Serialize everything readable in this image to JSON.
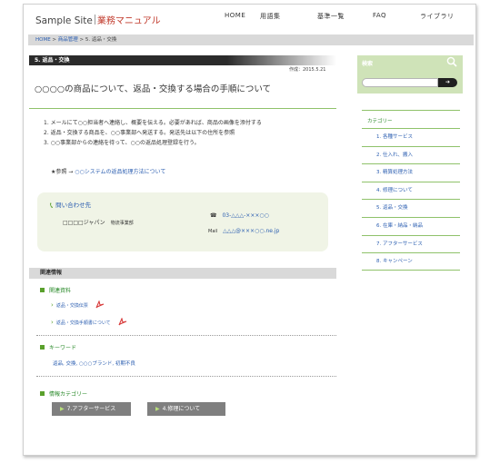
{
  "header": {
    "logo_main": "Sample Site",
    "logo_sub": "業務マニュアル",
    "nav": [
      "HOME",
      "用語集",
      "基準一覧",
      "FAQ",
      "ライブラリ"
    ]
  },
  "breadcrumb": {
    "home": "HOME",
    "sep": " > ",
    "parent": "商品管理",
    "current": "5. 返品・交換"
  },
  "page": {
    "section_label": "5. 返品・交換",
    "date": "作成：2015.5.21",
    "title": "○○○○の商品について、返品・交換する場合の手順について",
    "steps": [
      "1. メールにて○○担当者へ連絡し、概要を伝える。必要があれば、商品の画像を添付する",
      "2. 返品・交換する商品を、○○事業部へ発送する。発送先は以下の住所を参照",
      "3. ○○事業部からの連絡を待って、○○の返品処理登録を行う。"
    ],
    "star_prefix": "★参照 →",
    "star_link": "○○システムの返品処理方法について"
  },
  "contact": {
    "heading": "問い合わせ先",
    "org": "□□□□ジャパン",
    "dept": "物流事業部",
    "tel_icon": "☎",
    "tel": "03-△△△-×××○○",
    "mail_label": "Mail",
    "mail": "△△△@×××○○.ne.jp"
  },
  "related": {
    "bar": "関連情報",
    "materials_heading": "関連資料",
    "materials": [
      "返品・交換伝票",
      "返品・交換手順書について"
    ],
    "keywords_heading": "キーワード",
    "keywords": "返品, 交換, ○○○ブランド, 初期不良",
    "category_heading": "情報カテゴリー",
    "category_buttons": [
      "7.アフターサービス",
      "4.修理について"
    ]
  },
  "sidebar": {
    "search_label": "検索",
    "search_placeholder": "",
    "category_title": "カテゴリー",
    "categories": [
      "1. 各種サービス",
      "2. 仕入れ、搬入",
      "3. 精算処理方法",
      "4. 修理について",
      "5. 返品・交換",
      "6. 在庫・納品・納品",
      "7. アフターサービス",
      "8. キャンペーン"
    ]
  },
  "colors": {
    "accent_green": "#5aa02c",
    "link_blue": "#2a5db0",
    "logo_red": "#c0392b",
    "dark_bar": "#2b2b2b",
    "panel_green": "#f0f4e6"
  }
}
